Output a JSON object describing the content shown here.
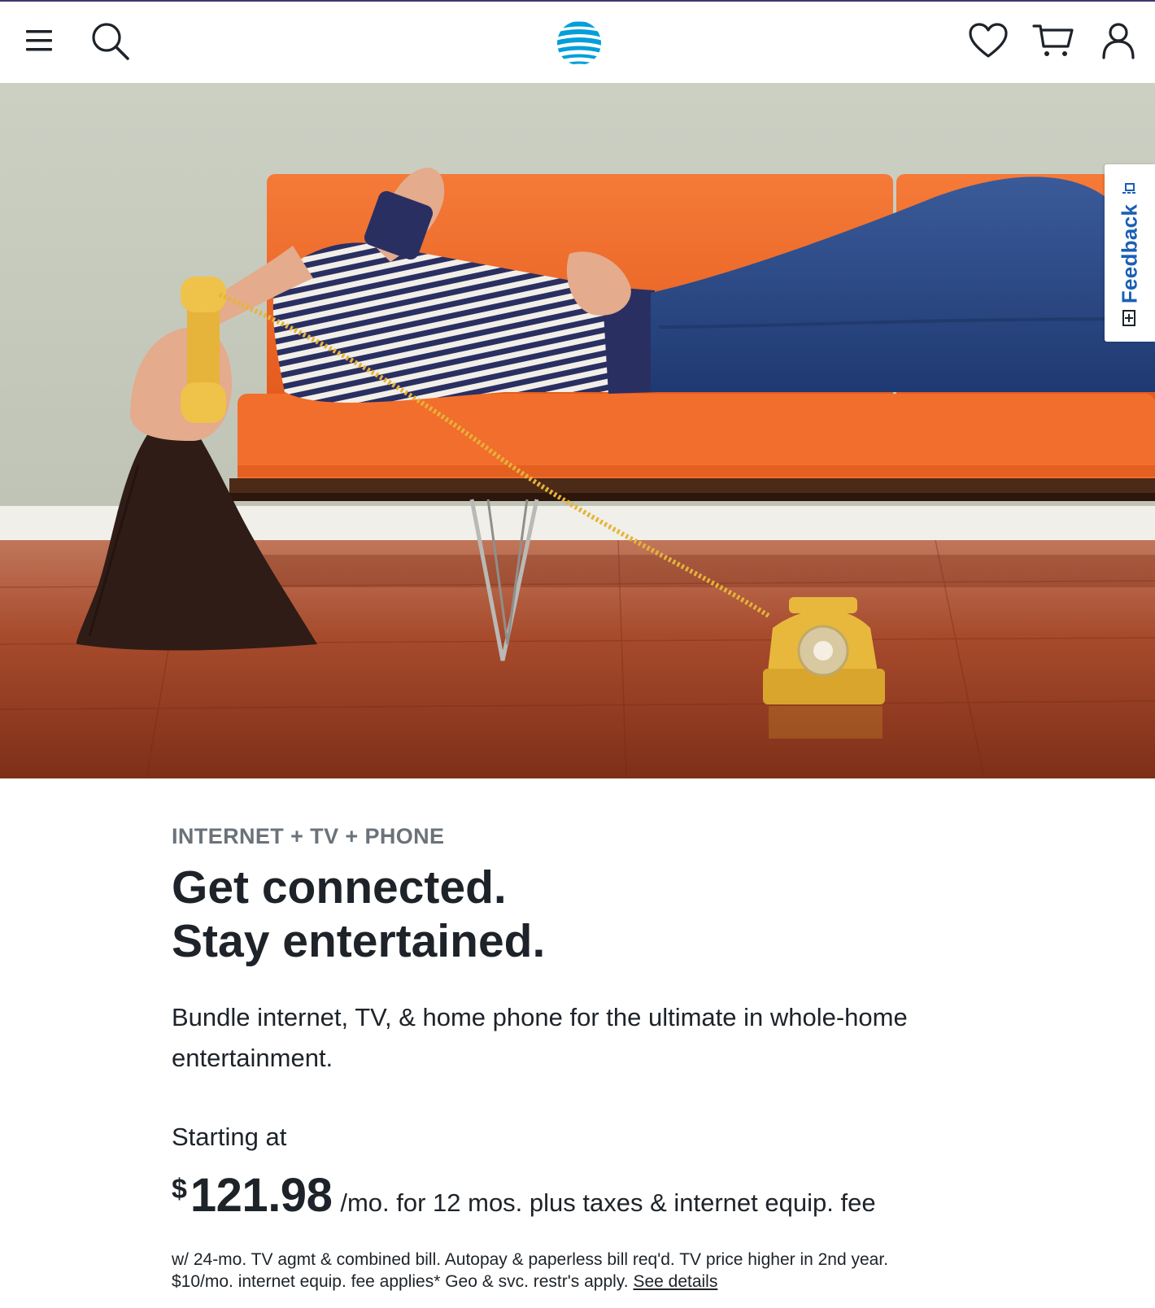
{
  "header": {
    "menu_icon": "hamburger-menu-icon",
    "search_icon": "search-icon",
    "logo": "att-globe-logo",
    "wishlist_icon": "heart-icon",
    "cart_icon": "cart-icon",
    "account_icon": "user-icon",
    "top_rule_color": "#3c3a6e",
    "logo_color": "#009fdb"
  },
  "hero": {
    "image_kind": "photo",
    "colors": {
      "wall": "#c6c9bd",
      "sofa": "#f26e2c",
      "floor": "#a4462a",
      "phone": "#e8b83c",
      "jeans": "#2c4a86"
    }
  },
  "feedback": {
    "label": "Feedback",
    "color": "#1a5fb4"
  },
  "content": {
    "eyebrow": "INTERNET + TV + PHONE",
    "headline_line1": "Get connected.",
    "headline_line2": "Stay entertained.",
    "subhead": "Bundle internet, TV, & home phone for the ultimate in whole-home entertainment.",
    "starting_at": "Starting at",
    "price_currency": "$",
    "price_amount": "121.98",
    "price_terms": "/mo. for 12 mos. plus taxes & internet equip. fee",
    "legal_line1": "w/ 24-mo. TV agmt & combined bill. Autopay & paperless bill req'd. TV price higher in 2nd year.",
    "legal_line2": "$10/mo. internet equip. fee applies* Geo & svc. restr's apply.",
    "see_details": "See details"
  }
}
